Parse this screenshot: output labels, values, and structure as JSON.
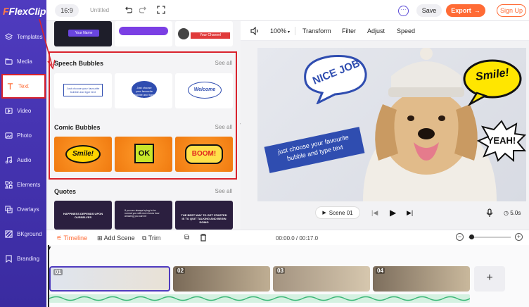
{
  "app": {
    "logo": "FlexClip"
  },
  "sidebar": {
    "items": [
      {
        "label": "Templates",
        "icon": "layers-icon"
      },
      {
        "label": "Media",
        "icon": "folder-icon"
      },
      {
        "label": "Text",
        "icon": "text-icon"
      },
      {
        "label": "Video",
        "icon": "video-icon"
      },
      {
        "label": "Photo",
        "icon": "photo-icon"
      },
      {
        "label": "Audio",
        "icon": "music-icon"
      },
      {
        "label": "Elements",
        "icon": "elements-icon"
      },
      {
        "label": "Overlays",
        "icon": "overlays-icon"
      },
      {
        "label": "BKground",
        "icon": "background-icon"
      },
      {
        "label": "Branding",
        "icon": "branding-icon"
      }
    ]
  },
  "header": {
    "ratio": "16:9",
    "title": "Untitled",
    "save": "Save",
    "export": "Export",
    "signup": "Sign Up"
  },
  "panel": {
    "speech_title": "Speech Bubbles",
    "comic_title": "Comic Bubbles",
    "quotes_title": "Quotes",
    "see_all": "See all",
    "speech_thumbs": [
      "Just choose your favourite bubble and type text",
      "Just choose your favourite bubble and type text",
      "Welcome"
    ],
    "comic_thumbs": [
      "Smile!",
      "OK",
      "BOOM!"
    ],
    "quote_thumbs": [
      "HAPPINESS DEPENDS UPON OURSELVES",
      "If you are always trying to be normal you will never know how amazing you can be",
      "THE BEST WAY TO GET STARTED IS TO QUIT TALKING AND BEGIN DOING"
    ],
    "top_thumb_text": [
      "Your Name",
      "Your Channel"
    ]
  },
  "toolbar": {
    "zoom": "100%",
    "transform": "Transform",
    "filter": "Filter",
    "adjust": "Adjust",
    "speed": "Speed"
  },
  "stage": {
    "nice_job": "NICE JOB",
    "banner": "just choose your favourite bubble and type text",
    "smile": "Smile!",
    "yeah": "YEAH!"
  },
  "playbar": {
    "scene": "Scene  01",
    "duration": "5.0s"
  },
  "timeline": {
    "tab": "Timeline",
    "add_scene": "Add Scene",
    "trim": "Trim",
    "time": "00:00.0 / 00:17.0",
    "clips": [
      "01",
      "02",
      "03",
      "04"
    ],
    "add": "+"
  },
  "colors": {
    "sidebar": "#4f3bbf",
    "accent": "#ff6b35",
    "highlight": "#d9232d",
    "banner": "#2f4db0"
  }
}
